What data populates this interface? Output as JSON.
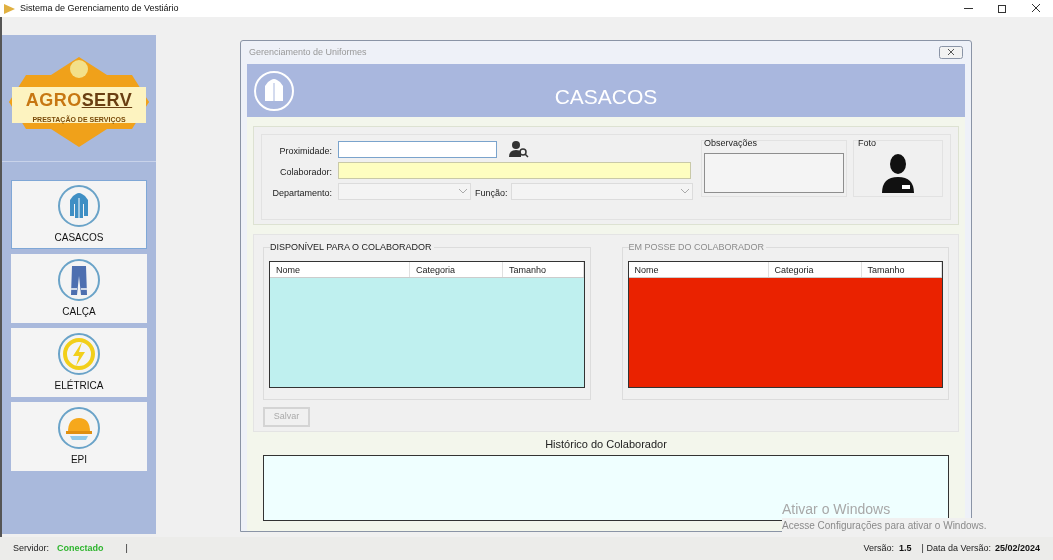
{
  "window": {
    "title": "Sistema de Gerenciamento de Vestiário"
  },
  "sidebar": {
    "logo": {
      "name": "AGRO",
      "name_bold": "SERV",
      "tagline": "PRESTAÇÃO DE SERVIÇOS"
    },
    "items": [
      {
        "label": "CASACOS",
        "kind": "jacket",
        "selected": true
      },
      {
        "label": "CALÇA",
        "kind": "pants",
        "selected": false
      },
      {
        "label": "ELÉTRICA",
        "kind": "electric",
        "selected": false
      },
      {
        "label": "EPI",
        "kind": "helmet",
        "selected": false
      }
    ]
  },
  "child_window": {
    "title": "Gerenciamento de Uniformes",
    "header": "CASACOS",
    "form": {
      "proximidade": {
        "label": "Proximidade:"
      },
      "colaborador": {
        "label": "Colaborador:"
      },
      "departamento": {
        "label": "Departamento:"
      },
      "funcao": {
        "label": "Função:"
      },
      "observacoes": {
        "label": "Observações"
      },
      "foto": {
        "label": "Foto"
      }
    },
    "lists": [
      {
        "title": "DISPONÍVEL PARA O COLABORADOR",
        "disabled": false,
        "color": "#bff0ef",
        "columns": [
          "Nome",
          "Categoria",
          "Tamanho"
        ]
      },
      {
        "title": "EM POSSE DO COLABORADOR",
        "disabled": true,
        "color": "#ea2200",
        "columns": [
          "Nome",
          "Categoria",
          "Tamanho"
        ]
      }
    ],
    "save_button": {
      "label": "Salvar",
      "disabled": true
    },
    "history": {
      "title": "Histórico do Colaborador"
    }
  },
  "activation_notice": {
    "title": "Ativar o Windows",
    "text": "Acesse Configurações para ativar o Windows."
  },
  "status_bar": {
    "server_label": "Servidor:",
    "server_status": "Conectado",
    "separator": "|",
    "version_label": "Versão:",
    "version": "1.5",
    "date_label": "| Data da Versão:",
    "date": "25/02/2024"
  }
}
